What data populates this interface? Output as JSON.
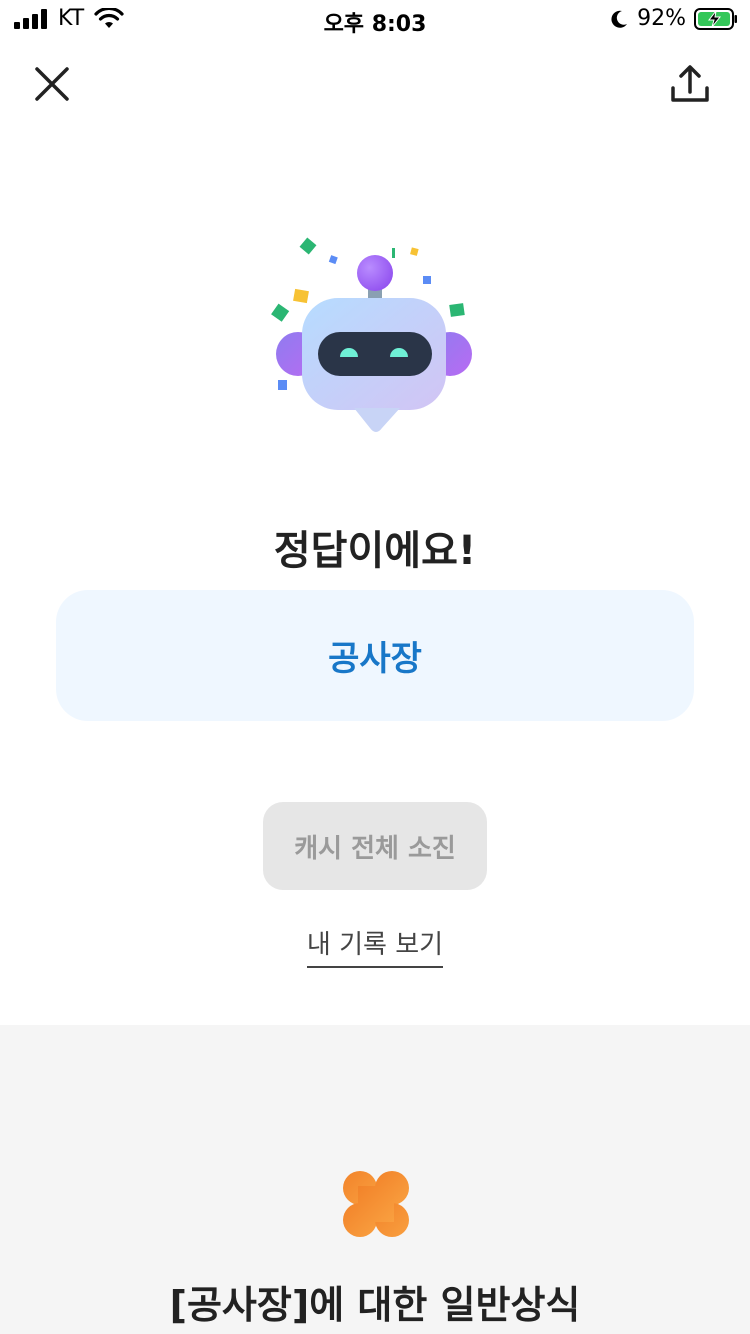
{
  "status_bar": {
    "carrier": "KT",
    "time": "오후 8:03",
    "battery": "92%"
  },
  "result": {
    "title": "정답이에요!",
    "answer": "공사장"
  },
  "actions": {
    "cash_button": "캐시 전체 소진",
    "history_link": "내 기록 보기"
  },
  "knowledge": {
    "title": "[공사장]에 대한 일반상식"
  },
  "colors": {
    "accent_blue": "#1877c8",
    "card_bg": "#eff7ff",
    "clover_orange": "#f58a2b"
  }
}
